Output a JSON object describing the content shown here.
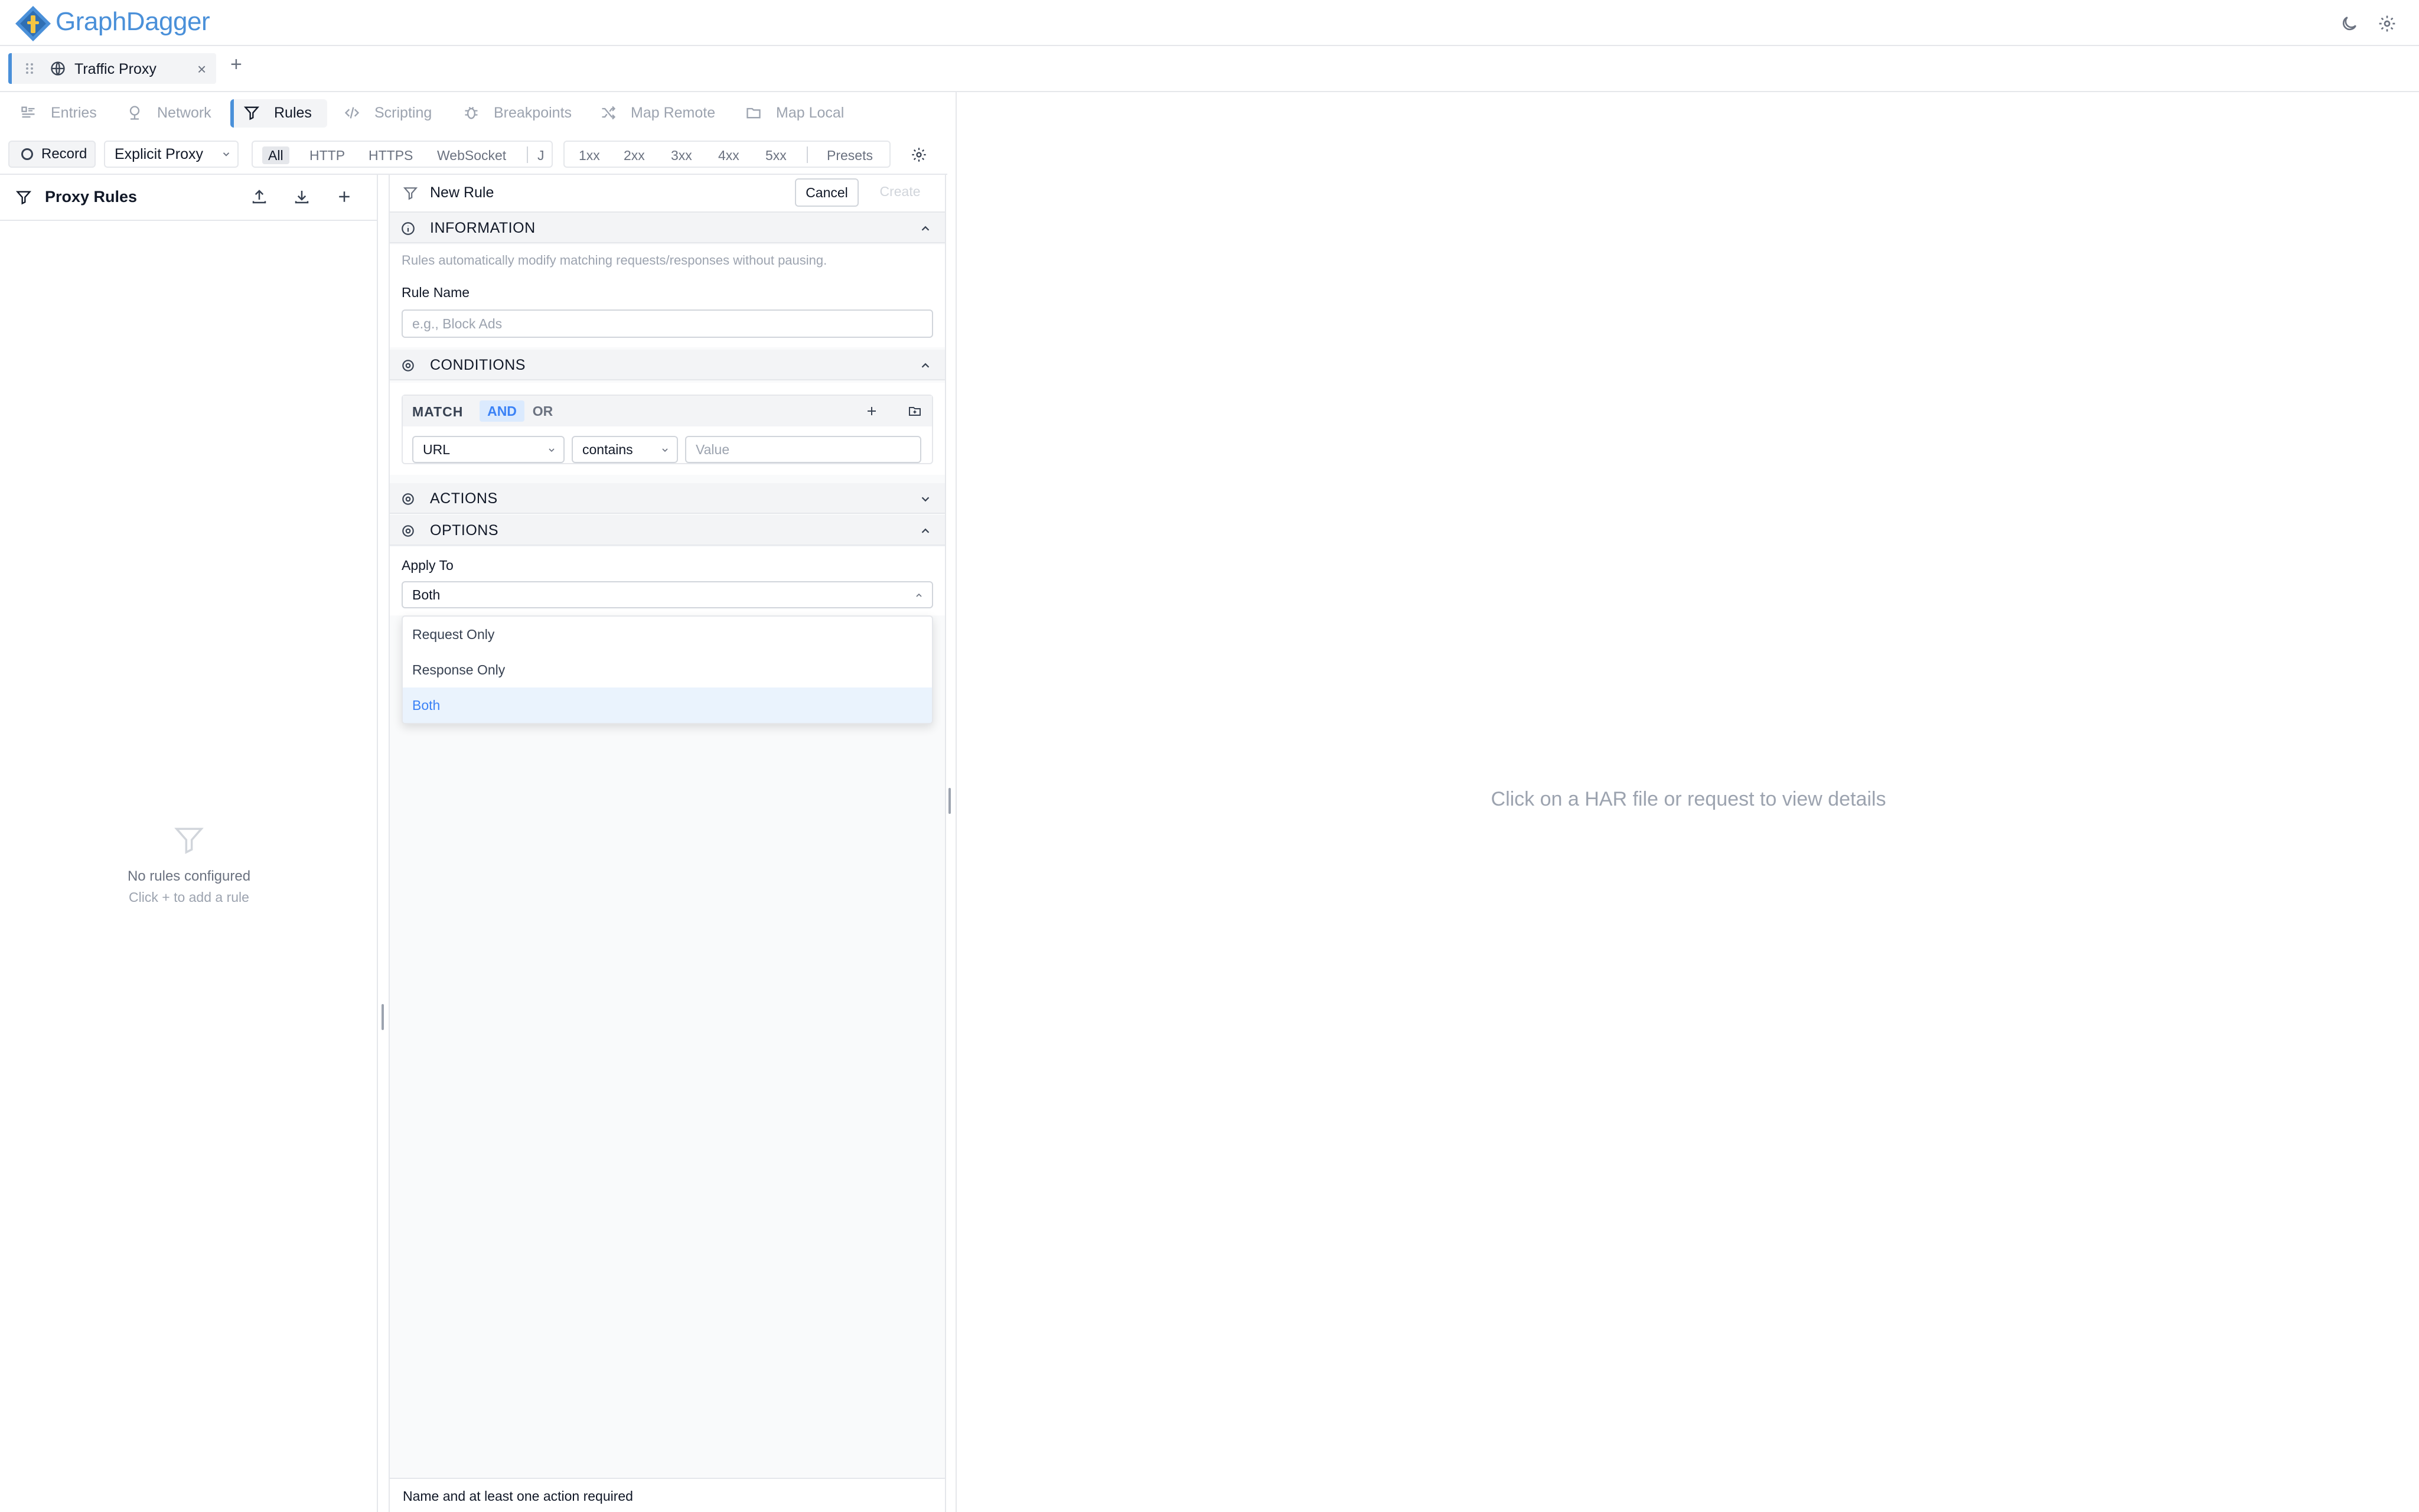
{
  "app": {
    "name": "GraphDagger",
    "brand_color": "#4a90d9"
  },
  "header": {
    "theme_icon": "moon-icon",
    "settings_icon": "gear-icon"
  },
  "tabs": [
    {
      "title": "Traffic Proxy",
      "icon": "globe-icon",
      "close": "×"
    }
  ],
  "new_tab": "+",
  "nav": [
    {
      "label": "Entries",
      "icon": "entries-icon"
    },
    {
      "label": "Network",
      "icon": "network-icon"
    },
    {
      "label": "Rules",
      "icon": "filter-icon",
      "active": true
    },
    {
      "label": "Scripting",
      "icon": "code-icon"
    },
    {
      "label": "Breakpoints",
      "icon": "bug-icon"
    },
    {
      "label": "Map Remote",
      "icon": "shuffle-icon"
    },
    {
      "label": "Map Local",
      "icon": "folder-icon"
    }
  ],
  "toolbar": {
    "record": "Record",
    "proxy_mode": "Explicit Proxy",
    "protocols": [
      "All",
      "HTTP",
      "HTTPS",
      "WebSocket",
      "J"
    ],
    "active_protocol": "All",
    "status_codes": [
      "1xx",
      "2xx",
      "3xx",
      "4xx",
      "5xx"
    ],
    "presets": "Presets"
  },
  "sidebar": {
    "title": "Proxy Rules",
    "empty_title": "No rules configured",
    "empty_subtitle": "Click + to add a rule"
  },
  "editor": {
    "title": "New Rule",
    "cancel": "Cancel",
    "create": "Create",
    "sections": {
      "information": "INFORMATION",
      "conditions": "CONDITIONS",
      "actions": "ACTIONS",
      "options": "OPTIONS"
    },
    "info_description": "Rules automatically modify matching requests/responses without pausing.",
    "rule_name_label": "Rule Name",
    "rule_name_placeholder": "e.g., Block Ads",
    "match_label": "MATCH",
    "and": "AND",
    "or": "OR",
    "condition": {
      "field": "URL",
      "operator": "contains",
      "value_placeholder": "Value"
    },
    "apply_to_label": "Apply To",
    "apply_to_value": "Both",
    "apply_to_options": [
      "Request Only",
      "Response Only",
      "Both"
    ],
    "footer": "Name and at least one action required"
  },
  "details": {
    "empty": "Click on a HAR file or request to view details"
  }
}
